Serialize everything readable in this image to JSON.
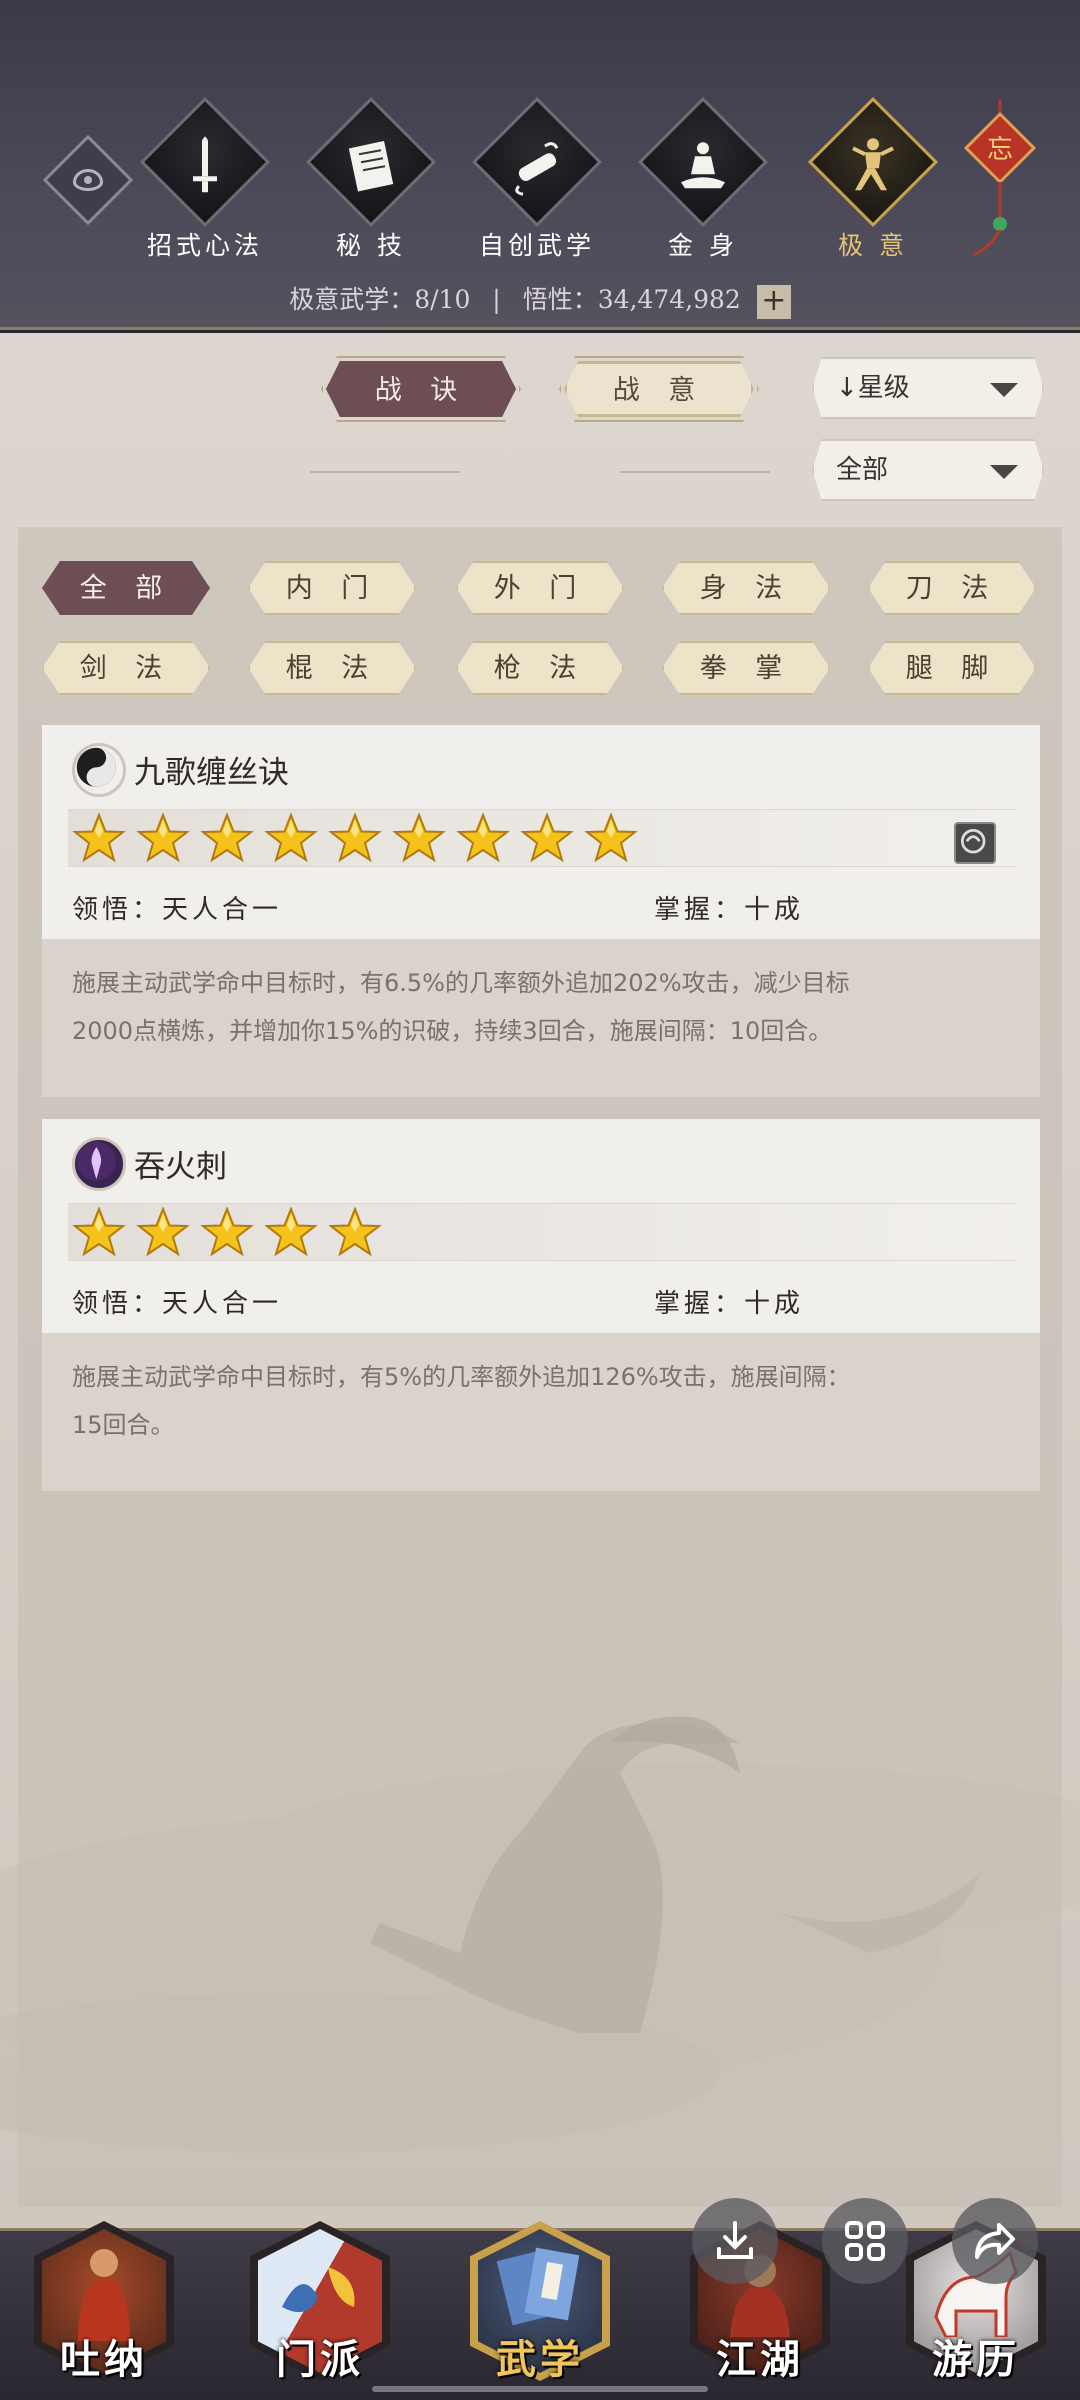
{
  "header": {
    "tabs": [
      {
        "label": "招式心法",
        "icon": "sword-icon"
      },
      {
        "label": "秘 技",
        "icon": "book-icon"
      },
      {
        "label": "自创武学",
        "icon": "scroll-icon"
      },
      {
        "label": "金 身",
        "icon": "meditation-icon"
      },
      {
        "label": "极 意",
        "icon": "martial-stance-icon"
      }
    ],
    "active_tab": "极 意",
    "knot_char": "忘",
    "stats": {
      "label1": "极意武学：",
      "value1": "8/10",
      "separator": "|",
      "label2": "悟性：",
      "value2": "34,474,982",
      "plus": "+"
    }
  },
  "mode_tabs": {
    "left": "战 诀",
    "right": "战 意",
    "active": "战 诀"
  },
  "sort": {
    "label": "↓星级",
    "filter_value": "全部"
  },
  "categories": [
    "全 部",
    "内 门",
    "外 门",
    "身 法",
    "刀 法",
    "剑 法",
    "棍 法",
    "枪 法",
    "拳 掌",
    "腿 脚"
  ],
  "active_category": "全 部",
  "skills": [
    {
      "name": "九歌缠丝诀",
      "stars": 9,
      "comprehension_label": "领悟：",
      "comprehension": "天人合一",
      "mastery_label": "掌握：",
      "mastery": "十成",
      "desc_line1": "施展主动武学命中目标时，有6.5%的几率额外追加202%攻击，减少目标",
      "desc_line2": "2000点横炼，并增加你15%的识破，持续3回合，施展间隔：10回合。"
    },
    {
      "name": "吞火刺",
      "stars": 5,
      "comprehension_label": "领悟：",
      "comprehension": "天人合一",
      "mastery_label": "掌握：",
      "mastery": "十成",
      "desc_line1": "施展主动武学命中目标时，有5%的几率额外追加126%攻击，施展间隔：",
      "desc_line2": "15回合。"
    }
  ],
  "bottom_nav": [
    {
      "label": "吐纳"
    },
    {
      "label": "门派"
    },
    {
      "label": "武学"
    },
    {
      "label": "江湖"
    },
    {
      "label": "游历"
    }
  ],
  "active_nav": "武学",
  "colors": {
    "accent_active": "#6d4e54",
    "gold": "#e2c47a",
    "card_bg": "#f1efec",
    "desc_bg": "#d9d3cc"
  }
}
